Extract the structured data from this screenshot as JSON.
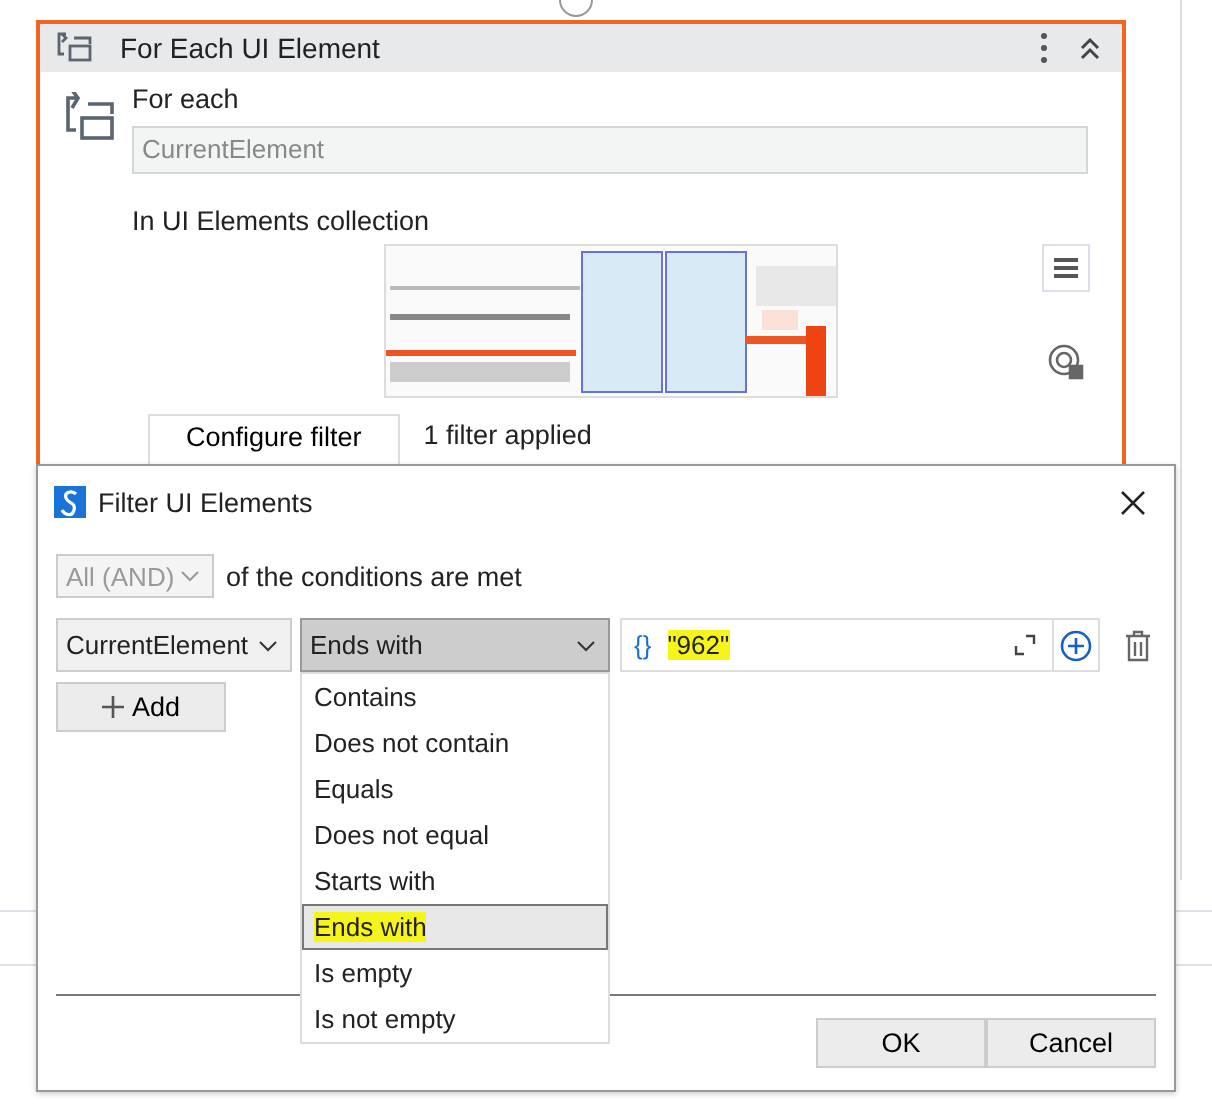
{
  "activity": {
    "title": "For Each UI Element",
    "selected": true,
    "for_each_label": "For each",
    "variable": "CurrentElement",
    "collection_label": "In UI Elements collection",
    "configure_button": "Configure filter",
    "filter_status": "1 filter applied"
  },
  "dialog": {
    "title": "Filter UI Elements",
    "match_mode": {
      "value": "All (AND)",
      "disabled": true
    },
    "match_text": "of the conditions are met",
    "conditions": [
      {
        "target": "CurrentElement",
        "operator": "Ends with",
        "operator_open": true,
        "value_marker": "{}",
        "value": "\"962\"",
        "value_highlighted": true
      }
    ],
    "operator_options": [
      {
        "label": "Contains",
        "selected": false,
        "highlighted": false
      },
      {
        "label": "Does not contain",
        "selected": false,
        "highlighted": false
      },
      {
        "label": "Equals",
        "selected": false,
        "highlighted": false
      },
      {
        "label": "Does not equal",
        "selected": false,
        "highlighted": false
      },
      {
        "label": "Starts with",
        "selected": false,
        "highlighted": false
      },
      {
        "label": "Ends with",
        "selected": true,
        "highlighted": true
      },
      {
        "label": "Is empty",
        "selected": false,
        "highlighted": false
      },
      {
        "label": "Is not empty",
        "selected": false,
        "highlighted": false
      }
    ],
    "add_button": "Add",
    "buttons": [
      "OK",
      "Cancel"
    ]
  }
}
